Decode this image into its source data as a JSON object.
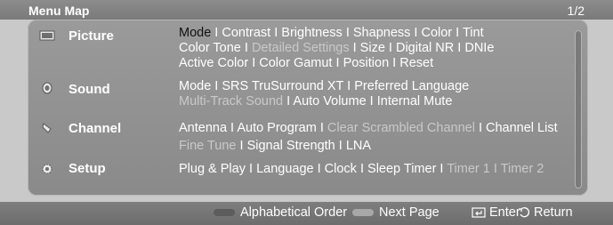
{
  "header": {
    "title": "Menu Map",
    "page": "1/2"
  },
  "rows": [
    {
      "label": "Picture",
      "icon": "picture-icon",
      "lines": [
        [
          {
            "t": "Mode",
            "s": "hl"
          },
          {
            "t": " I ",
            "s": "sep"
          },
          {
            "t": "Contrast",
            "s": "n"
          },
          {
            "t": " I ",
            "s": "sep"
          },
          {
            "t": "Brightness",
            "s": "n"
          },
          {
            "t": " I ",
            "s": "sep"
          },
          {
            "t": "Shapness",
            "s": "n"
          },
          {
            "t": " I ",
            "s": "sep"
          },
          {
            "t": "Color",
            "s": "n"
          },
          {
            "t": " I ",
            "s": "sep"
          },
          {
            "t": "Tint",
            "s": "n"
          }
        ],
        [
          {
            "t": "Color Tone",
            "s": "n"
          },
          {
            "t": " I ",
            "s": "sep"
          },
          {
            "t": "Detailed Settings",
            "s": "dim"
          },
          {
            "t": " I ",
            "s": "sep"
          },
          {
            "t": "Size",
            "s": "n"
          },
          {
            "t": " I ",
            "s": "sep"
          },
          {
            "t": "Digital NR",
            "s": "n"
          },
          {
            "t": " I ",
            "s": "sep"
          },
          {
            "t": "DNIe",
            "s": "n"
          }
        ],
        [
          {
            "t": "Active Color",
            "s": "n"
          },
          {
            "t": " I ",
            "s": "sep"
          },
          {
            "t": "Color Gamut",
            "s": "n"
          },
          {
            "t": " I ",
            "s": "sep"
          },
          {
            "t": "Position",
            "s": "n"
          },
          {
            "t": " I ",
            "s": "sep"
          },
          {
            "t": "Reset",
            "s": "n"
          }
        ]
      ]
    },
    {
      "label": "Sound",
      "icon": "sound-icon",
      "lines": [
        [
          {
            "t": "Mode",
            "s": "n"
          },
          {
            "t": " I ",
            "s": "sep"
          },
          {
            "t": "SRS TruSurround XT",
            "s": "n"
          },
          {
            "t": " I ",
            "s": "sep"
          },
          {
            "t": "Preferred Language",
            "s": "n"
          }
        ],
        [
          {
            "t": "Multi-Track Sound",
            "s": "dim"
          },
          {
            "t": " I ",
            "s": "sep"
          },
          {
            "t": "Auto Volume",
            "s": "n"
          },
          {
            "t": " I ",
            "s": "sep"
          },
          {
            "t": "Internal Mute",
            "s": "n"
          }
        ]
      ]
    },
    {
      "label": "Channel",
      "icon": "channel-icon",
      "lines": [
        [
          {
            "t": "Antenna",
            "s": "n"
          },
          {
            "t": " I ",
            "s": "sep"
          },
          {
            "t": "Auto Program",
            "s": "n"
          },
          {
            "t": " I ",
            "s": "sep"
          },
          {
            "t": "Clear Scrambled Channel",
            "s": "dim"
          },
          {
            "t": " I ",
            "s": "sep"
          },
          {
            "t": "Channel List",
            "s": "n"
          }
        ],
        [
          {
            "t": "Fine Tune",
            "s": "dim"
          },
          {
            "t": " I ",
            "s": "sep"
          },
          {
            "t": "Signal Strength",
            "s": "n"
          },
          {
            "t": " I ",
            "s": "sep"
          },
          {
            "t": "LNA",
            "s": "n"
          }
        ]
      ]
    },
    {
      "label": "Setup",
      "icon": "setup-icon",
      "lines": [
        [
          {
            "t": "Plug & Play",
            "s": "n"
          },
          {
            "t": " I ",
            "s": "sep"
          },
          {
            "t": "Language",
            "s": "n"
          },
          {
            "t": " I ",
            "s": "sep"
          },
          {
            "t": "Clock",
            "s": "n"
          },
          {
            "t": " I ",
            "s": "sep"
          },
          {
            "t": "Sleep Timer",
            "s": "n"
          },
          {
            "t": " I ",
            "s": "sep"
          },
          {
            "t": "Timer 1",
            "s": "dim"
          },
          {
            "t": " I ",
            "s": "dim"
          },
          {
            "t": "Timer 2",
            "s": "dim"
          }
        ]
      ]
    }
  ],
  "footer": {
    "alphabetical": "Alphabetical Order",
    "next_page": "Next Page",
    "enter": "Enter",
    "return": "Return"
  },
  "colors": {
    "highlight": "#111111",
    "disabled": "#c9c9c9",
    "text": "#ffffff"
  }
}
